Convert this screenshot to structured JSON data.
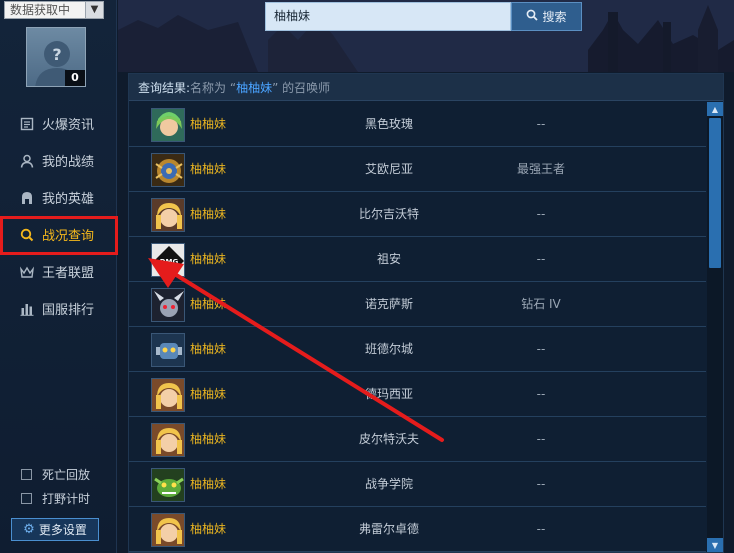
{
  "sidebar": {
    "status_select": {
      "value": "数据获取中"
    },
    "avatar_badge": "0",
    "nav": [
      {
        "label": "火爆资讯",
        "icon": "news-icon"
      },
      {
        "label": "我的战绩",
        "icon": "person-icon"
      },
      {
        "label": "我的英雄",
        "icon": "hero-helmet-icon"
      },
      {
        "label": "战况查询",
        "icon": "search-icon",
        "active": true
      },
      {
        "label": "王者联盟",
        "icon": "crown-icon"
      },
      {
        "label": "国服排行",
        "icon": "bar-chart-icon"
      }
    ],
    "checks": [
      {
        "label": "死亡回放"
      },
      {
        "label": "打野计时"
      }
    ],
    "settings_label": "更多设置"
  },
  "search": {
    "value": "柚柚妹",
    "button_label": "搜索"
  },
  "results": {
    "header_label": "查询结果:",
    "header_pre": " 名称为 “",
    "header_name": "柚柚妹",
    "header_post": "” 的召唤师",
    "rows": [
      {
        "name": "柚柚妹",
        "server": "黑色玫瑰",
        "rank": "--",
        "avatar": "green-hair"
      },
      {
        "name": "柚柚妹",
        "server": "艾欧尼亚",
        "rank": "最强王者",
        "avatar": "gold-crest"
      },
      {
        "name": "柚柚妹",
        "server": "比尔吉沃特",
        "rank": "--",
        "avatar": "blonde-girl"
      },
      {
        "name": "柚柚妹",
        "server": "祖安",
        "rank": "--",
        "avatar": "dmg-logo"
      },
      {
        "name": "柚柚妹",
        "server": "诺克萨斯",
        "rank": "钻石 IV",
        "avatar": "horned-demon"
      },
      {
        "name": "柚柚妹",
        "server": "班德尔城",
        "rank": "--",
        "avatar": "blue-robot"
      },
      {
        "name": "柚柚妹",
        "server": "德玛西亚",
        "rank": "--",
        "avatar": "blonde-girl"
      },
      {
        "name": "柚柚妹",
        "server": "皮尔特沃夫",
        "rank": "--",
        "avatar": "blonde-girl"
      },
      {
        "name": "柚柚妹",
        "server": "战争学院",
        "rank": "--",
        "avatar": "green-goblin"
      },
      {
        "name": "柚柚妹",
        "server": "弗雷尔卓德",
        "rank": "--",
        "avatar": "blonde-girl"
      }
    ]
  },
  "colors": {
    "accent_gold": "#f5b81c",
    "highlight_red": "#e51c1c",
    "link_blue": "#4aa3ff"
  }
}
